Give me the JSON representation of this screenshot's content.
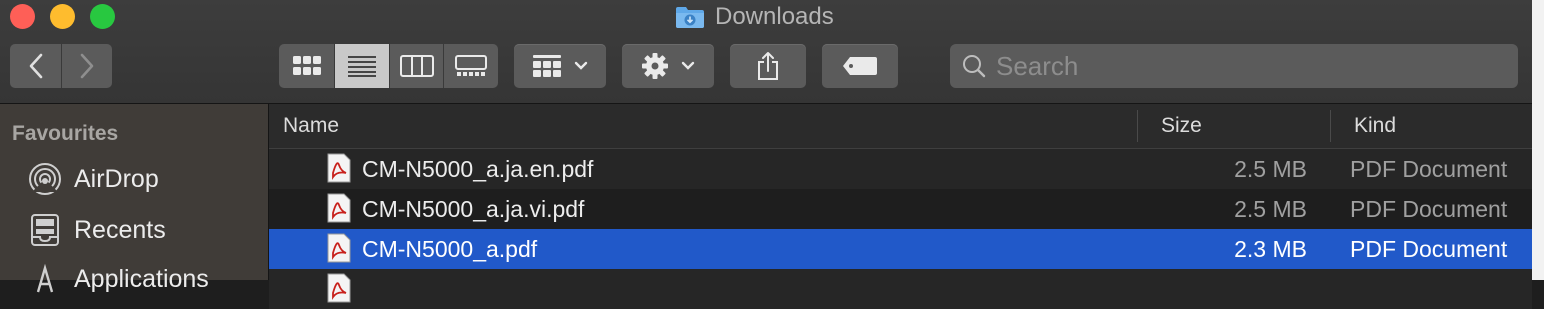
{
  "window": {
    "title": "Downloads"
  },
  "toolbar": {
    "nav": {
      "back_icon": "chevron-left-icon",
      "forward_icon": "chevron-right-icon"
    },
    "view_modes": [
      "icon-view",
      "list-view",
      "column-view",
      "gallery-view"
    ],
    "active_view": "list-view",
    "group_icon": "group-grid-icon",
    "action_icon": "gear-icon",
    "share_icon": "share-icon",
    "tags_icon": "tag-icon"
  },
  "search": {
    "placeholder": "Search",
    "value": ""
  },
  "sidebar": {
    "heading": "Favourites",
    "items": [
      {
        "label": "AirDrop",
        "icon": "airdrop-icon"
      },
      {
        "label": "Recents",
        "icon": "recents-icon"
      },
      {
        "label": "Applications",
        "icon": "applications-icon"
      }
    ]
  },
  "columns": {
    "name": "Name",
    "size": "Size",
    "kind": "Kind"
  },
  "files": [
    {
      "name": "CM-N5000_a.ja.en.pdf",
      "size": "2.5 MB",
      "kind": "PDF Document",
      "selected": false
    },
    {
      "name": "CM-N5000_a.ja.vi.pdf",
      "size": "2.5 MB",
      "kind": "PDF Document",
      "selected": false
    },
    {
      "name": "CM-N5000_a.pdf",
      "size": "2.3 MB",
      "kind": "PDF Document",
      "selected": true
    }
  ],
  "colors": {
    "selection": "#2159c9",
    "sidebar": "#403c38",
    "toolbar": "#383838",
    "pdf_red": "#c8201b"
  }
}
